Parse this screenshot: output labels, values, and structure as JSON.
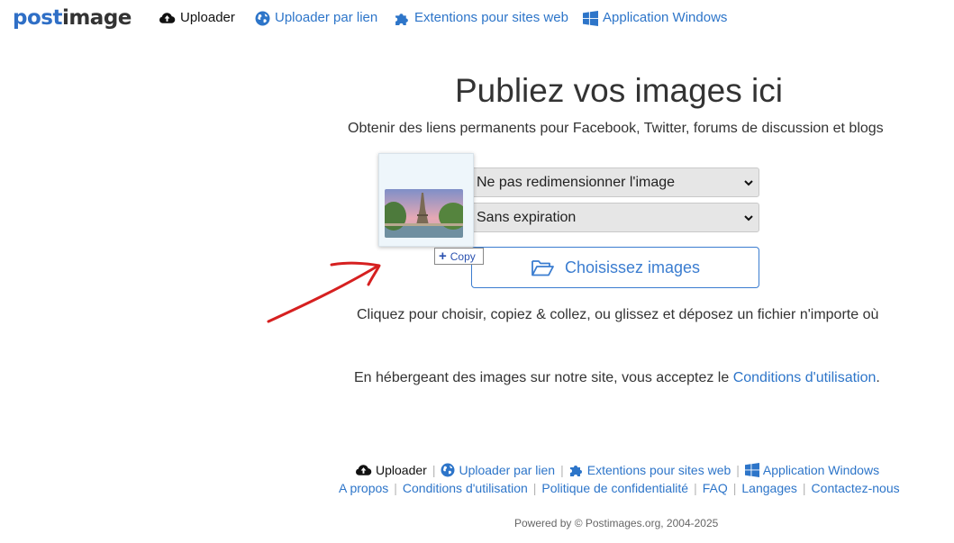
{
  "nav": {
    "logo_post": "post",
    "logo_image": "image",
    "uploader": "Uploader",
    "link_uploader": "Uploader par lien",
    "extensions": "Extentions pour sites web",
    "windows_app": "Application Windows"
  },
  "main": {
    "title": "Publiez vos images ici",
    "subtitle": "Obtenir des liens permanents pour Facebook, Twitter, forums de discussion et blogs",
    "resize_select": {
      "selected": "Ne pas redimensionner l'image"
    },
    "expiration_select": {
      "selected": "Sans expiration"
    },
    "choose_button": "Choisissez images",
    "drag_tooltip": "Copy",
    "hint": "Cliquez pour choisir, copiez & collez, ou glissez et déposez un fichier n'importe où",
    "terms_prefix": "En hébergeant des images sur notre site, vous acceptez le ",
    "terms_link": "Conditions d'utilisation",
    "terms_suffix": "."
  },
  "footer": {
    "uploader": "Uploader",
    "link_uploader": "Uploader par lien",
    "extensions": "Extentions pour sites web",
    "windows_app": "Application Windows",
    "about": "A propos",
    "terms": "Conditions d'utilisation",
    "privacy": "Politique de confidentialité",
    "faq": "FAQ",
    "languages": "Langages",
    "contact": "Contactez-nous",
    "separator": "|",
    "powered": "Powered by © Postimages.org, 2004-2025"
  },
  "icons": {
    "cloud_upload": "cloud-upload-icon",
    "globe": "globe-icon",
    "puzzle": "puzzle-icon",
    "windows": "windows-icon",
    "folder_open": "folder-open-icon",
    "plus": "plus-icon"
  },
  "colors": {
    "link_blue": "#2d75c9",
    "button_blue": "#3b7dd0",
    "annotation_red": "#d62020"
  }
}
